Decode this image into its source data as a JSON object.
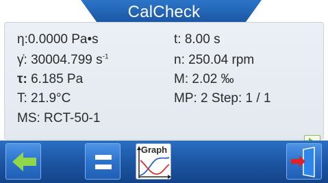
{
  "header": {
    "title": "CalCheck"
  },
  "measurements": {
    "viscosity": {
      "symbol": "η:",
      "value": "0.0000 Pa•s"
    },
    "shear_rate": {
      "symbol": "γ̇:",
      "value": "30004.799 s",
      "unit_exponent": "-1"
    },
    "shear_stress": {
      "symbol": "τ:",
      "value": "6.185 Pa"
    },
    "temperature": "T: 21.9°C",
    "system": "MS: RCT-50-1",
    "time": "t: 8.00 s",
    "speed": "n:  250.04 rpm",
    "torque": "M: 2.02 ‰",
    "profile": "MP: 2 Step: 1 / 1"
  },
  "toolbar": {
    "graph_label": "Graph"
  },
  "icons": {
    "back": "arrow-left-icon",
    "menu": "equals-menu-icon",
    "graph": "graph-icon",
    "exit": "exit-door-icon",
    "play": "play-icon"
  },
  "colors": {
    "header_blue": "#1d5fb3",
    "toolbar_blue": "#1e58a6",
    "accent_green": "#8fd84a",
    "exit_red": "#e02424"
  }
}
